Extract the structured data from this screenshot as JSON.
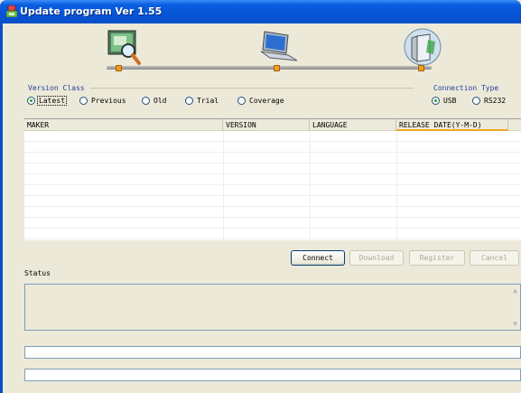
{
  "window": {
    "title": "Update program Ver 1.55"
  },
  "icons": [
    "search-icon",
    "laptop-icon",
    "server-icon"
  ],
  "version_class": {
    "label": "Version Class",
    "options": [
      "Latest",
      "Previous",
      "Old",
      "Trial",
      "Coverage"
    ],
    "selected": "Latest"
  },
  "connection_type": {
    "label": "Connection Type",
    "options": [
      "USB",
      "RS232"
    ],
    "selected": "USB"
  },
  "table": {
    "columns": [
      "MAKER",
      "VERSION",
      "LANGUAGE",
      "RELEASE DATE(Y-M-D)"
    ],
    "rows": []
  },
  "buttons": {
    "connect": "Connect",
    "download": "Download",
    "register": "Register",
    "cancel": "Cancel"
  },
  "status": {
    "label": "Status"
  },
  "colors": {
    "titlebar": "#0654d6",
    "accent_text": "#1f3f9f",
    "radio_selected": "#21a121"
  }
}
